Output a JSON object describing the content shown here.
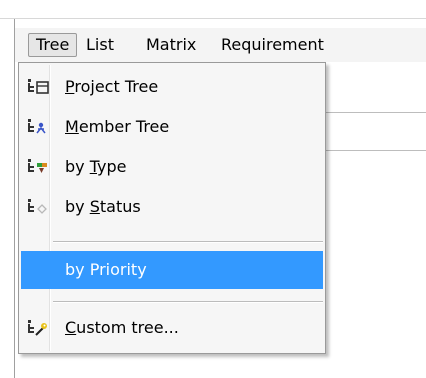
{
  "menubar": {
    "items": [
      {
        "label": "Tree",
        "active": true
      },
      {
        "label": "List",
        "active": false
      },
      {
        "label": "Matrix",
        "active": false
      },
      {
        "label": "Requirement",
        "active": false
      }
    ]
  },
  "tree_menu": {
    "items": [
      {
        "pre": "",
        "accel": "P",
        "post": "roject Tree",
        "icon": "project-tree-icon"
      },
      {
        "pre": "",
        "accel": "M",
        "post": "ember Tree",
        "icon": "member-tree-icon"
      },
      {
        "pre": "by ",
        "accel": "T",
        "post": "ype",
        "icon": "type-tree-icon"
      },
      {
        "pre": "by ",
        "accel": "S",
        "post": "tatus",
        "icon": "status-tree-icon"
      },
      {
        "pre": "by Priority",
        "accel": "",
        "post": "",
        "icon": "",
        "highlighted": true
      },
      {
        "pre": "",
        "accel": "C",
        "post": "ustom tree...",
        "icon": "custom-tree-icon"
      }
    ]
  },
  "colors": {
    "highlight": "#3399ff",
    "menu_bg": "#f6f6f6"
  }
}
